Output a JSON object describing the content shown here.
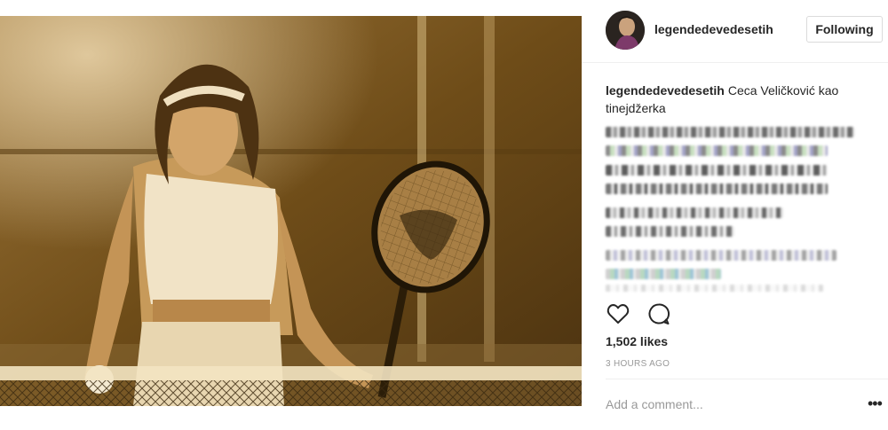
{
  "post": {
    "username": "legendedevedesetih",
    "follow_label": "Following",
    "caption_author": "legendedevedesetih",
    "caption_text": "Ceca Veličković kao tinejdžerka",
    "likes": "1,502 likes",
    "time_ago": "3 HOURS AGO",
    "comment_placeholder": "Add a comment...",
    "more_label": "•••"
  },
  "icons": {
    "like": "heart-outline-icon",
    "comment": "speech-bubble-icon",
    "more": "ellipsis-icon"
  },
  "colors": {
    "text": "#262626",
    "muted": "#999999",
    "border": "#dbdbdb",
    "photo_tone": "#b07a2c"
  }
}
